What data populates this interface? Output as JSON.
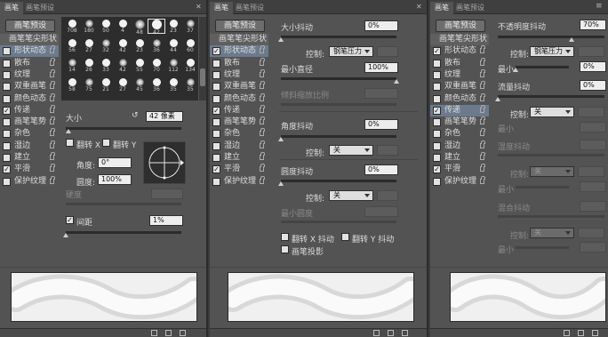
{
  "p1": {
    "tabs": [
      "画笔",
      "画笔预设"
    ],
    "preset_button": "画笔预设",
    "list": [
      {
        "label": "画笔笔尖形状",
        "checkbox": false,
        "lock": false,
        "state": "head"
      },
      {
        "label": "形状动态",
        "checkbox": true,
        "lock": true,
        "state": "sel"
      },
      {
        "label": "散布",
        "checkbox": true,
        "lock": true
      },
      {
        "label": "纹理",
        "checkbox": true,
        "lock": true
      },
      {
        "label": "双重画笔",
        "checkbox": true,
        "lock": true
      },
      {
        "label": "颜色动态",
        "checkbox": true,
        "lock": true
      },
      {
        "label": "传递",
        "checkbox": true,
        "checked": true,
        "lock": true
      },
      {
        "label": "画笔笔势",
        "checkbox": true,
        "lock": true
      },
      {
        "label": "杂色",
        "checkbox": true,
        "lock": true
      },
      {
        "label": "湿边",
        "checkbox": true,
        "lock": true
      },
      {
        "label": "建立",
        "checkbox": true,
        "lock": true
      },
      {
        "label": "平滑",
        "checkbox": true,
        "checked": true,
        "lock": true
      },
      {
        "label": "保护纹理",
        "checkbox": true,
        "lock": true
      }
    ],
    "tips": [
      "708",
      "180",
      "50",
      "4",
      "48",
      "42",
      "23",
      "37",
      "56",
      "27",
      "32",
      "42",
      "23",
      "36",
      "44",
      "60",
      "14",
      "26",
      "33",
      "42",
      "55",
      "70",
      "112",
      "134",
      "58",
      "75",
      "21",
      "27",
      "45",
      "36",
      "35",
      "35"
    ],
    "size_label": "大小",
    "size_value": "42 像素",
    "flip_x": "翻转 X",
    "flip_y": "翻转 Y",
    "angle_label": "角度:",
    "angle_value": "0°",
    "roundness_label": "圆度:",
    "roundness_value": "100%",
    "hardness_label": "硬度",
    "spacing_label": "间距",
    "spacing_value": "1%",
    "spacing_checked": true
  },
  "p2": {
    "tabs": [
      "画笔",
      "画笔预设"
    ],
    "preset_button": "画笔预设",
    "list": [
      {
        "label": "画笔笔尖形状",
        "checkbox": false,
        "lock": false,
        "state": "head"
      },
      {
        "label": "形状动态",
        "checkbox": true,
        "checked": true,
        "lock": true,
        "state": "sel"
      },
      {
        "label": "散布",
        "checkbox": true,
        "lock": true
      },
      {
        "label": "纹理",
        "checkbox": true,
        "lock": true
      },
      {
        "label": "双重画笔",
        "checkbox": true,
        "lock": true
      },
      {
        "label": "颜色动态",
        "checkbox": true,
        "lock": true
      },
      {
        "label": "传递",
        "checkbox": true,
        "checked": true,
        "lock": true
      },
      {
        "label": "画笔笔势",
        "checkbox": true,
        "lock": true
      },
      {
        "label": "杂色",
        "checkbox": true,
        "lock": true
      },
      {
        "label": "湿边",
        "checkbox": true,
        "lock": true
      },
      {
        "label": "建立",
        "checkbox": true,
        "lock": true
      },
      {
        "label": "平滑",
        "checkbox": true,
        "checked": true,
        "lock": true
      },
      {
        "label": "保护纹理",
        "checkbox": true,
        "lock": true
      }
    ],
    "size_jitter_label": "大小抖动",
    "size_jitter_value": "0%",
    "control_label": "控制:",
    "control_value_1": "钢笔压力",
    "min_diameter_label": "最小直径",
    "min_diameter_value": "100%",
    "tilt_scale_label": "倾斜缩放比例",
    "angle_jitter_label": "角度抖动",
    "angle_jitter_value": "0%",
    "control_value_2": "关",
    "roundness_jitter_label": "圆度抖动",
    "roundness_jitter_value": "0%",
    "control_value_3": "关",
    "min_roundness_label": "最小圆度",
    "flip_x_jitter": "翻转 X 抖动",
    "flip_y_jitter": "翻转 Y 抖动",
    "brush_projection": "画笔投影"
  },
  "p3": {
    "tabs": [
      "画笔",
      "画笔预设"
    ],
    "preset_button": "画笔预设",
    "list": [
      {
        "label": "画笔笔尖形状",
        "checkbox": false,
        "lock": false,
        "state": "head"
      },
      {
        "label": "形状动态",
        "checkbox": true,
        "checked": true,
        "lock": true
      },
      {
        "label": "散布",
        "checkbox": true,
        "lock": true
      },
      {
        "label": "纹理",
        "checkbox": true,
        "lock": true
      },
      {
        "label": "双重画笔",
        "checkbox": true,
        "lock": true
      },
      {
        "label": "颜色动态",
        "checkbox": true,
        "lock": true
      },
      {
        "label": "传递",
        "checkbox": true,
        "checked": true,
        "lock": true,
        "state": "sel"
      },
      {
        "label": "画笔笔势",
        "checkbox": true,
        "lock": true
      },
      {
        "label": "杂色",
        "checkbox": true,
        "lock": true
      },
      {
        "label": "湿边",
        "checkbox": true,
        "lock": true
      },
      {
        "label": "建立",
        "checkbox": true,
        "lock": true
      },
      {
        "label": "平滑",
        "checkbox": true,
        "checked": true,
        "lock": true
      },
      {
        "label": "保护纹理",
        "checkbox": true,
        "lock": true
      }
    ],
    "opacity_jitter_label": "不透明度抖动",
    "opacity_jitter_value": "70%",
    "control_label": "控制:",
    "control_value_1": "钢笔压力",
    "min_label": "最小",
    "min_value": "0%",
    "flow_jitter_label": "流量抖动",
    "flow_jitter_value": "0%",
    "control_value_2": "关",
    "min_label_2": "最小",
    "wetness_jitter_label": "湿度抖动",
    "control_value_3": "关",
    "min_label_3": "最小",
    "mix_jitter_label": "混合抖动",
    "control_value_4": "关",
    "min_label_4": "最小"
  }
}
